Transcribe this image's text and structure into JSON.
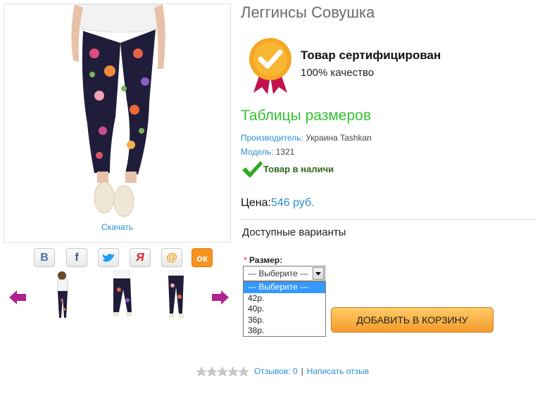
{
  "product": {
    "title": "Леггинсы Совушка",
    "download_link": "Скачать"
  },
  "social": {
    "items": [
      {
        "name": "vk",
        "glyph": "В",
        "color": "#4a76a8"
      },
      {
        "name": "facebook",
        "glyph": "f",
        "color": "#3b5998"
      },
      {
        "name": "twitter",
        "glyph": "🐦",
        "color": "#1da1f2"
      },
      {
        "name": "yandex",
        "glyph": "Я",
        "color": "#e0262d"
      },
      {
        "name": "mail",
        "glyph": "@",
        "color": "#f59a00"
      },
      {
        "name": "odnoklassniki",
        "glyph": "ок",
        "color": "#f7931e"
      }
    ]
  },
  "certificate": {
    "title": "Товар сертифицирован",
    "subtitle": "100% качество"
  },
  "sizes_link": "Таблицы размеров",
  "manufacturer": {
    "label": "Производитель:",
    "value": "Украина Tashkan"
  },
  "model": {
    "label": "Модель:",
    "value": "1321"
  },
  "stock": "Товар в наличи",
  "price": {
    "label": "Цена:",
    "value": "546 руб."
  },
  "variants_title": "Доступные варианты",
  "size_field": {
    "required_mark": "*",
    "label": "Размер:",
    "selected": "--- Выберите ---",
    "options": [
      "--- Выберите ---",
      "42р.",
      "40р.",
      "36р.",
      "38р."
    ]
  },
  "add_to_cart": "ДОБАВИТЬ В КОРЗИНУ",
  "reviews": {
    "rating": 0,
    "count_label": "Отзывов: 0",
    "separator": "|",
    "write_link": "Написать отзыв"
  },
  "colors": {
    "link": "#2a8fd1",
    "green": "#33c233",
    "arrow": "#b0238f"
  }
}
